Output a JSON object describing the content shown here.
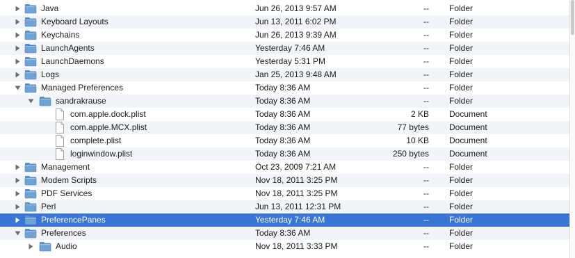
{
  "rows": [
    {
      "name": "Java",
      "date": "Jun 26, 2013 9:57 AM",
      "size": "--",
      "kind": "Folder",
      "type": "folder",
      "depth": 0,
      "disclosure": "collapsed",
      "selected": false
    },
    {
      "name": "Keyboard Layouts",
      "date": "Jun 13, 2011 6:02 PM",
      "size": "--",
      "kind": "Folder",
      "type": "folder",
      "depth": 0,
      "disclosure": "collapsed",
      "selected": false
    },
    {
      "name": "Keychains",
      "date": "Jun 26, 2013 9:39 AM",
      "size": "--",
      "kind": "Folder",
      "type": "folder",
      "depth": 0,
      "disclosure": "collapsed",
      "selected": false
    },
    {
      "name": "LaunchAgents",
      "date": "Yesterday 7:46 AM",
      "size": "--",
      "kind": "Folder",
      "type": "folder",
      "depth": 0,
      "disclosure": "collapsed",
      "selected": false
    },
    {
      "name": "LaunchDaemons",
      "date": "Yesterday 5:31 PM",
      "size": "--",
      "kind": "Folder",
      "type": "folder",
      "depth": 0,
      "disclosure": "collapsed",
      "selected": false
    },
    {
      "name": "Logs",
      "date": "Jan 25, 2013 9:48 AM",
      "size": "--",
      "kind": "Folder",
      "type": "folder",
      "depth": 0,
      "disclosure": "collapsed",
      "selected": false
    },
    {
      "name": "Managed Preferences",
      "date": "Today 8:36 AM",
      "size": "--",
      "kind": "Folder",
      "type": "folder",
      "depth": 0,
      "disclosure": "expanded",
      "selected": false
    },
    {
      "name": "sandrakrause",
      "date": "Today 8:36 AM",
      "size": "--",
      "kind": "Folder",
      "type": "folder",
      "depth": 1,
      "disclosure": "expanded",
      "selected": false
    },
    {
      "name": "com.apple.dock.plist",
      "date": "Today 8:36 AM",
      "size": "2 KB",
      "kind": "Document",
      "type": "document",
      "depth": 2,
      "disclosure": "none",
      "selected": false
    },
    {
      "name": "com.apple.MCX.plist",
      "date": "Today 8:36 AM",
      "size": "77 bytes",
      "kind": "Document",
      "type": "document",
      "depth": 2,
      "disclosure": "none",
      "selected": false
    },
    {
      "name": "complete.plist",
      "date": "Today 8:36 AM",
      "size": "10 KB",
      "kind": "Document",
      "type": "document",
      "depth": 2,
      "disclosure": "none",
      "selected": false
    },
    {
      "name": "loginwindow.plist",
      "date": "Today 8:36 AM",
      "size": "250 bytes",
      "kind": "Document",
      "type": "document",
      "depth": 2,
      "disclosure": "none",
      "selected": false
    },
    {
      "name": "Management",
      "date": "Oct 23, 2009 7:21 AM",
      "size": "--",
      "kind": "Folder",
      "type": "folder",
      "depth": 0,
      "disclosure": "collapsed",
      "selected": false
    },
    {
      "name": "Modem Scripts",
      "date": "Nov 18, 2011 3:25 PM",
      "size": "--",
      "kind": "Folder",
      "type": "folder",
      "depth": 0,
      "disclosure": "collapsed",
      "selected": false
    },
    {
      "name": "PDF Services",
      "date": "Nov 18, 2011 3:25 PM",
      "size": "--",
      "kind": "Folder",
      "type": "folder",
      "depth": 0,
      "disclosure": "collapsed",
      "selected": false
    },
    {
      "name": "Perl",
      "date": "Jun 13, 2011 12:31 PM",
      "size": "--",
      "kind": "Folder",
      "type": "folder",
      "depth": 0,
      "disclosure": "collapsed",
      "selected": false
    },
    {
      "name": "PreferencePanes",
      "date": "Yesterday 7:46 AM",
      "size": "--",
      "kind": "Folder",
      "type": "folder",
      "depth": 0,
      "disclosure": "collapsed",
      "selected": true
    },
    {
      "name": "Preferences",
      "date": "Today 8:36 AM",
      "size": "--",
      "kind": "Folder",
      "type": "folder",
      "depth": 0,
      "disclosure": "expanded",
      "selected": false
    },
    {
      "name": "Audio",
      "date": "Nov 18, 2011 3:33 PM",
      "size": "--",
      "kind": "Folder",
      "type": "folder",
      "depth": 1,
      "disclosure": "collapsed",
      "selected": false
    }
  ],
  "colors": {
    "selection": "#3875d7",
    "alternate_row": "#f1f5fa",
    "folder_fill": "#6fa3d6",
    "folder_tab": "#5b8fc4",
    "triangle": "#6e6e6e"
  }
}
